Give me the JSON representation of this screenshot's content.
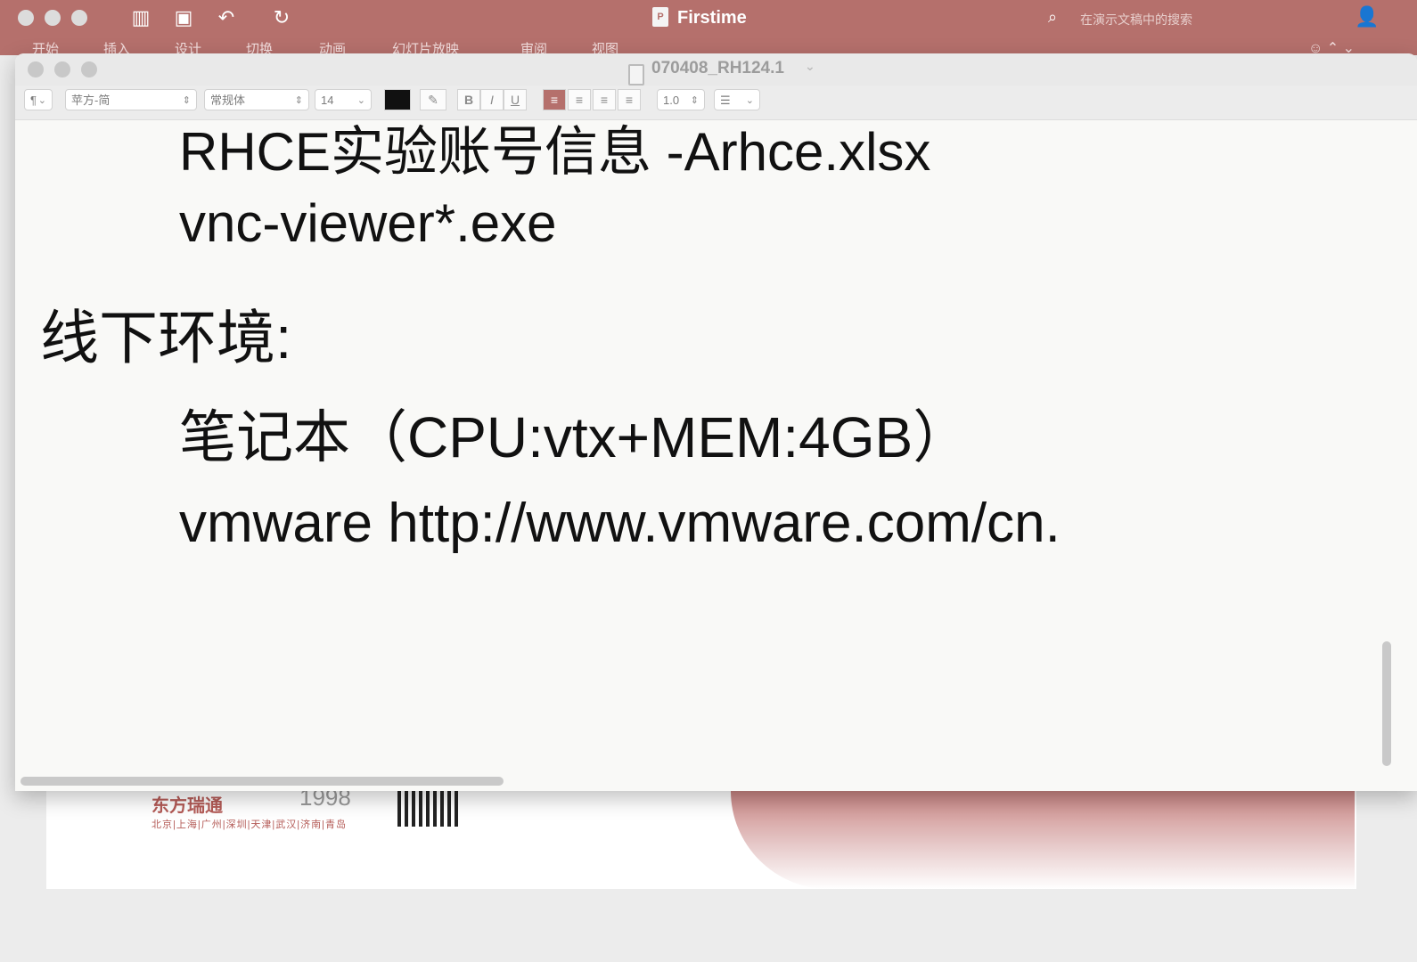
{
  "ppt_window": {
    "title": "Firstime",
    "file_icon_letter": "P",
    "search_placeholder": "在演示文稿中的搜索",
    "tabs": [
      "开始",
      "插入",
      "设计",
      "切换",
      "动画",
      "幻灯片放映",
      "审阅",
      "视图"
    ],
    "accent_color": "#b5706c",
    "slide_background": {
      "logo_text": "东方瑞通",
      "year": "1998",
      "cities": "北京|上海|广州|深圳|天津|武汉|济南|青岛"
    }
  },
  "doc_window": {
    "title": "070408_RH124.1",
    "toolbar": {
      "paragraph_style": "¶",
      "font_family": "苹方-简",
      "font_style": "常规体",
      "font_size": "14",
      "bold": "B",
      "italic": "I",
      "underline": "U",
      "line_spacing": "1.0"
    },
    "lines": [
      "RHCE实验账号信息 -Arhce.xlsx",
      "vnc-viewer*.exe",
      "线下环境:",
      "笔记本（CPU:vtx+MEM:4GB）",
      "vmware  http://www.vmware.com/cn."
    ]
  }
}
